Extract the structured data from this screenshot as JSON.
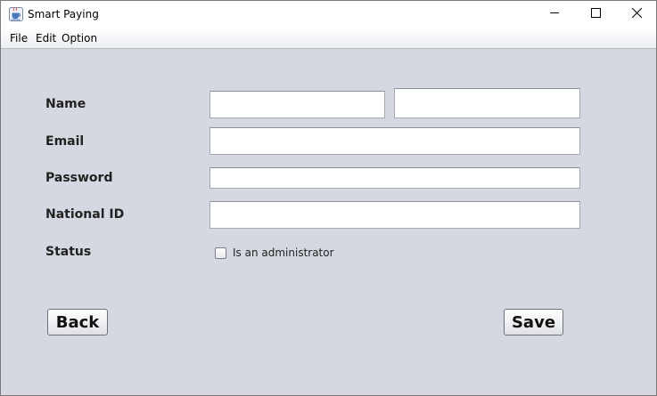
{
  "window": {
    "title": "Smart Paying",
    "icons": {
      "app": "java-cup-icon",
      "minimize": "minimize-icon",
      "maximize": "maximize-icon",
      "close": "close-icon"
    }
  },
  "menu": {
    "items": [
      "File",
      "Edit",
      "Option"
    ]
  },
  "form": {
    "name_label": "Name",
    "first_name_value": "",
    "last_name_value": "",
    "email_label": "Email",
    "email_value": "",
    "password_label": "Password",
    "password_value": "",
    "national_id_label": "National ID",
    "national_id_value": "",
    "status_label": "Status",
    "admin_checkbox_label": "Is an administrator",
    "admin_checked": false
  },
  "buttons": {
    "back": "Back",
    "save": "Save"
  },
  "colors": {
    "background": "#d5d8e0",
    "titlebar": "#ffffff",
    "field_bg": "#ffffff"
  }
}
